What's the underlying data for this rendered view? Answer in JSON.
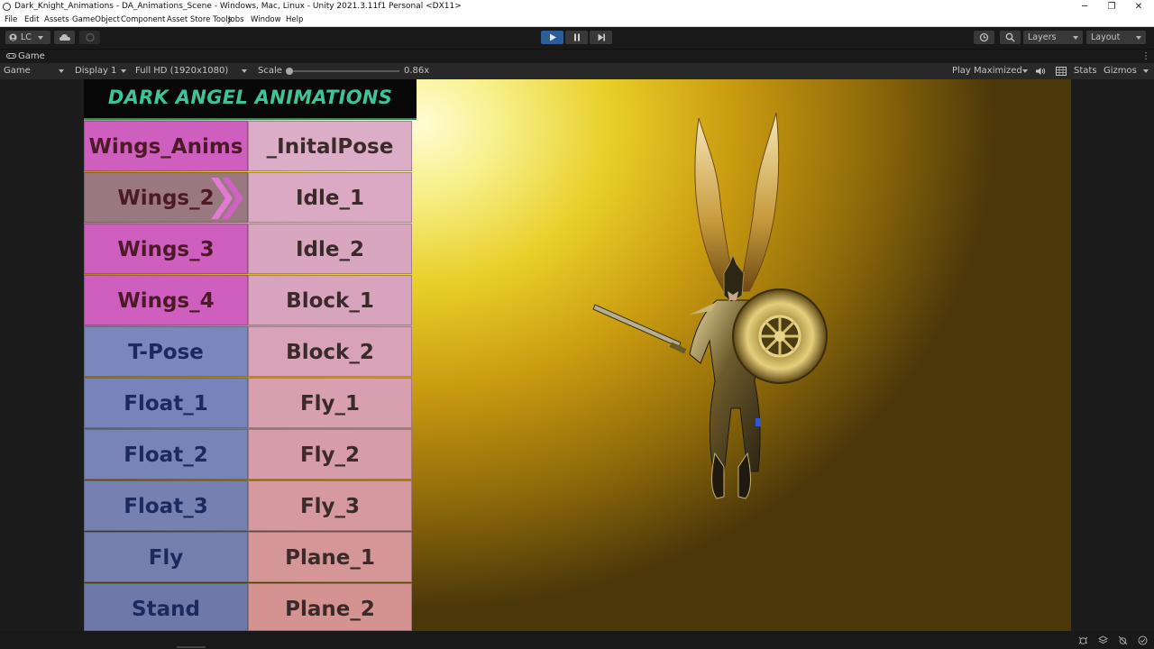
{
  "window": {
    "title": "Dark_Knight_Animations - DA_Animations_Scene - Windows, Mac, Linux - Unity 2021.3.11f1 Personal <DX11>",
    "controls": [
      "─",
      "❐",
      "✕"
    ]
  },
  "menu": [
    "File",
    "Edit",
    "Assets",
    "GameObject",
    "Component",
    "Asset Store Tools",
    "Jobs",
    "Window",
    "Help"
  ],
  "toolbar": {
    "account": "LC",
    "layers": "Layers",
    "layout": "Layout"
  },
  "tab": {
    "label": "Game"
  },
  "gamebar": {
    "view": "Game",
    "display": "Display 1",
    "resolution": "Full HD (1920x1080)",
    "scale_label": "Scale",
    "scale_value": "0.86x",
    "play_mode": "Play Maximized",
    "stats": "Stats",
    "gizmos": "Gizmos"
  },
  "game": {
    "banner": "DARK ANGEL ANIMATIONS",
    "left_buttons": [
      "Wings_Anims",
      "Wings_2",
      "Wings_3",
      "Wings_4",
      "T-Pose",
      "Float_1",
      "Float_2",
      "Float_3",
      "Fly",
      "Stand"
    ],
    "right_buttons": [
      "_InitalPose",
      "Idle_1",
      "Idle_2",
      "Block_1",
      "Block_2",
      "Fly_1",
      "Fly_2",
      "Fly_3",
      "Plane_1",
      "Plane_2"
    ],
    "selected": "Wings_2"
  },
  "icons": {
    "play": "play-icon",
    "pause": "pause-icon",
    "step": "step-icon",
    "cloud": "cloud-icon",
    "collab": "collab-icon",
    "history": "history-icon",
    "search": "search-icon"
  },
  "colors": {
    "play_active": "#2b5d99",
    "pink_button": "#cf5fbf",
    "blue_button": "#7684bc",
    "selected_button": "#9a7880",
    "right_column": "#d7a8c0",
    "banner_text": "#3ec39a"
  }
}
